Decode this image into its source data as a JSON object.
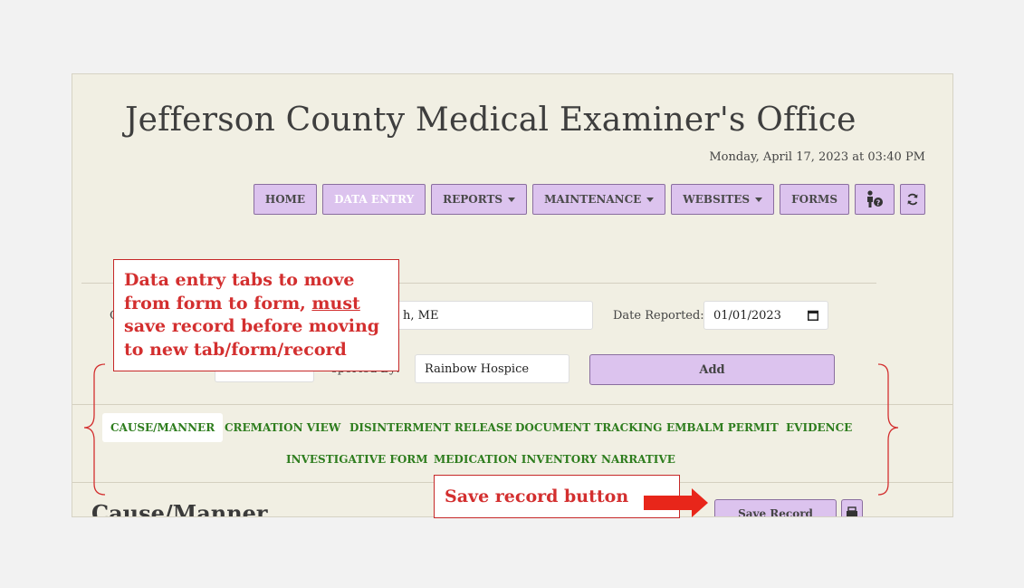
{
  "header": {
    "title": "Jefferson County Medical Examiner's Office",
    "datetime": "Monday, April 17, 2023 at 03:40 PM"
  },
  "nav": {
    "items": [
      {
        "label": "HOME",
        "active": false,
        "dropdown": false
      },
      {
        "label": "DATA ENTRY",
        "active": true,
        "dropdown": false
      },
      {
        "label": "REPORTS",
        "active": false,
        "dropdown": true
      },
      {
        "label": "MAINTENANCE",
        "active": false,
        "dropdown": true
      },
      {
        "label": "WEBSITES",
        "active": false,
        "dropdown": true
      },
      {
        "label": "FORMS",
        "active": false,
        "dropdown": false
      }
    ],
    "help_icon": "person-help-icon",
    "refresh_icon": "refresh-icon"
  },
  "form": {
    "row1_label_fragment": "C",
    "location_value": "h, ME",
    "date_reported_label": "Date Reported:",
    "date_reported_value": "01/01/2023",
    "reported_by_label_fragment": "eported By:",
    "reported_by_value": "Rainbow Hospice",
    "add_button": "Add"
  },
  "tabs": [
    {
      "label": "CAUSE/MANNER",
      "active": true
    },
    {
      "label": "CREMATION VIEW",
      "active": false
    },
    {
      "label": "DISINTERMENT RELEASE",
      "active": false
    },
    {
      "label": "DOCUMENT TRACKING",
      "active": false
    },
    {
      "label": "EMBALM PERMIT",
      "active": false
    },
    {
      "label": "EVIDENCE",
      "active": false
    },
    {
      "label": "INVESTIGATIVE FORM",
      "active": false
    },
    {
      "label": "MEDICATION INVENTORY",
      "active": false
    },
    {
      "label": "NARRATIVE",
      "active": false
    }
  ],
  "section": {
    "title": "Cause/Manner",
    "save_button": "Save Record",
    "print_icon": "printer-icon"
  },
  "annotations": {
    "callout1_part1": "Data entry tabs to move from form to form, ",
    "callout1_emph": "must",
    "callout1_part2": " save record before moving to new tab/form/record",
    "callout2": "Save record button"
  },
  "colors": {
    "page_bg": "#f1efe3",
    "button_bg": "#dcc3ee",
    "tab_text": "#2e7d1e",
    "annotation_red": "#d32f2f"
  }
}
